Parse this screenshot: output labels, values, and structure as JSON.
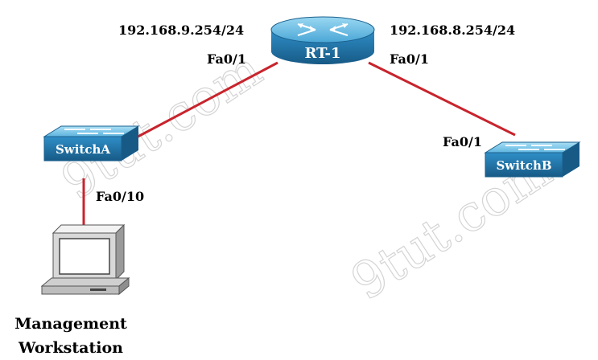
{
  "watermark": "9tut.com",
  "colors": {
    "link": "#c8242d",
    "device_blue": "#2a86c0",
    "device_blue_dark": "#1a5f8c",
    "device_top": "#7ec8ea"
  },
  "router": {
    "name": "RT-1",
    "icon": "router-icon"
  },
  "switch_a": {
    "name": "SwitchA",
    "icon": "switch-icon"
  },
  "switch_b": {
    "name": "SwitchB",
    "icon": "switch-icon"
  },
  "workstation": {
    "icon": "workstation-icon",
    "label_line1": "Management",
    "label_line2": "Workstation"
  },
  "labels": {
    "ip_left": "192.168.9.254/24",
    "ip_right": "192.168.8.254/24",
    "rt_port_left": "Fa0/1",
    "rt_port_right": "Fa0/1",
    "switch_b_port": "Fa0/1",
    "switch_a_port": "Fa0/10"
  }
}
